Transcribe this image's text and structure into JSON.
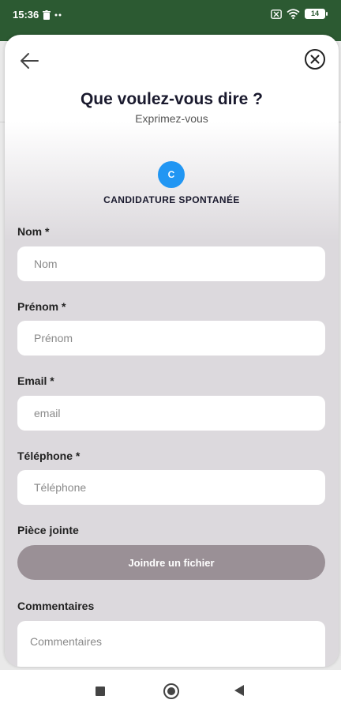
{
  "status_bar": {
    "time": "15:36",
    "battery": "14",
    "icons": [
      "trash-icon",
      "more-dots-icon",
      "sim-off-icon",
      "wifi-icon",
      "battery-icon"
    ]
  },
  "header": {
    "back_icon": "arrow-left-icon",
    "close_icon": "close-circle-icon",
    "title": "Que voulez-vous dire ?",
    "subtitle": "Exprimez-vous"
  },
  "category": {
    "avatar_letter": "C",
    "avatar_color": "#2196f3",
    "label": "CANDIDATURE SPONTANÉE"
  },
  "form": {
    "nom": {
      "label": "Nom *",
      "placeholder": "Nom",
      "value": ""
    },
    "prenom": {
      "label": "Prénom *",
      "placeholder": "Prénom",
      "value": ""
    },
    "email": {
      "label": "Email *",
      "placeholder": "email",
      "value": ""
    },
    "telephone": {
      "label": "Téléphone *",
      "placeholder": "Téléphone",
      "value": ""
    },
    "piece_jointe": {
      "label": "Pièce jointe",
      "button": "Joindre un fichier"
    },
    "commentaires": {
      "label": "Commentaires",
      "placeholder": "Commentaires",
      "value": ""
    }
  },
  "colors": {
    "status_bar": "#2c5a32",
    "attach_button": "#9a9096",
    "sheet_bottom": "#dcd9dd",
    "text_dark": "#1a1a2e"
  },
  "nav_bar": {
    "icons": [
      "recents-square-icon",
      "home-circle-icon",
      "back-triangle-icon"
    ]
  }
}
